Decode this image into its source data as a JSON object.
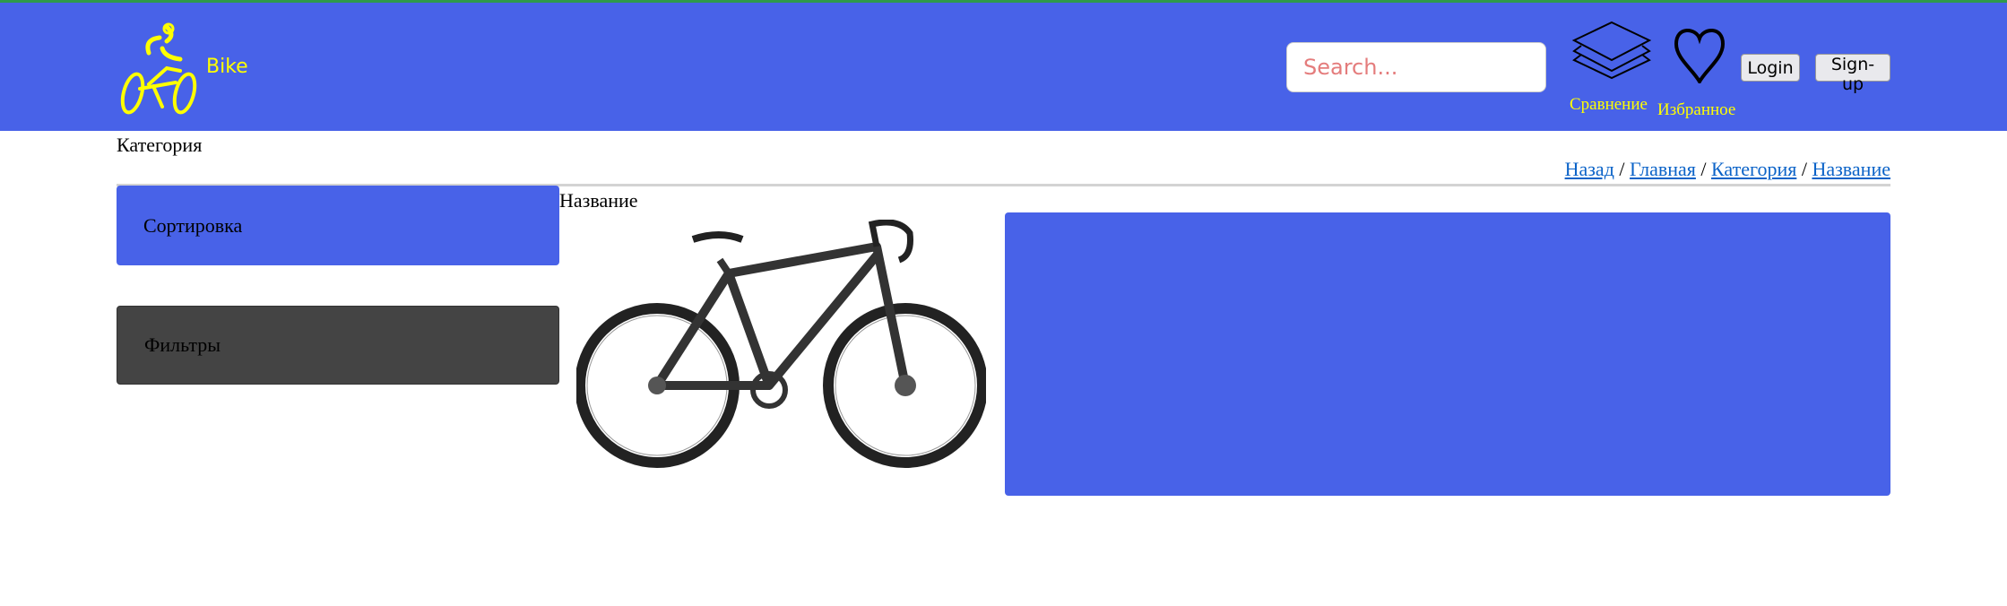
{
  "header": {
    "logo_text": "Bike",
    "search_placeholder": "Search...",
    "compare_label": "Сравнение",
    "favorites_label": "Избранное",
    "login_label": "Login",
    "signup_label": "Sign-up"
  },
  "page": {
    "category_title": "Категория",
    "product_title": "Название"
  },
  "breadcrumb": [
    {
      "label": "Назад"
    },
    {
      "label": "Главная"
    },
    {
      "label": "Категория"
    },
    {
      "label": "Название"
    }
  ],
  "breadcrumb_separator": "/",
  "sidebar": {
    "sort_label": "Сортировка",
    "filters_label": "Фильтры"
  },
  "colors": {
    "brand": "#4862e8",
    "accent": "#ffff00",
    "filters_bg": "#444444",
    "link": "#0b63c8"
  }
}
